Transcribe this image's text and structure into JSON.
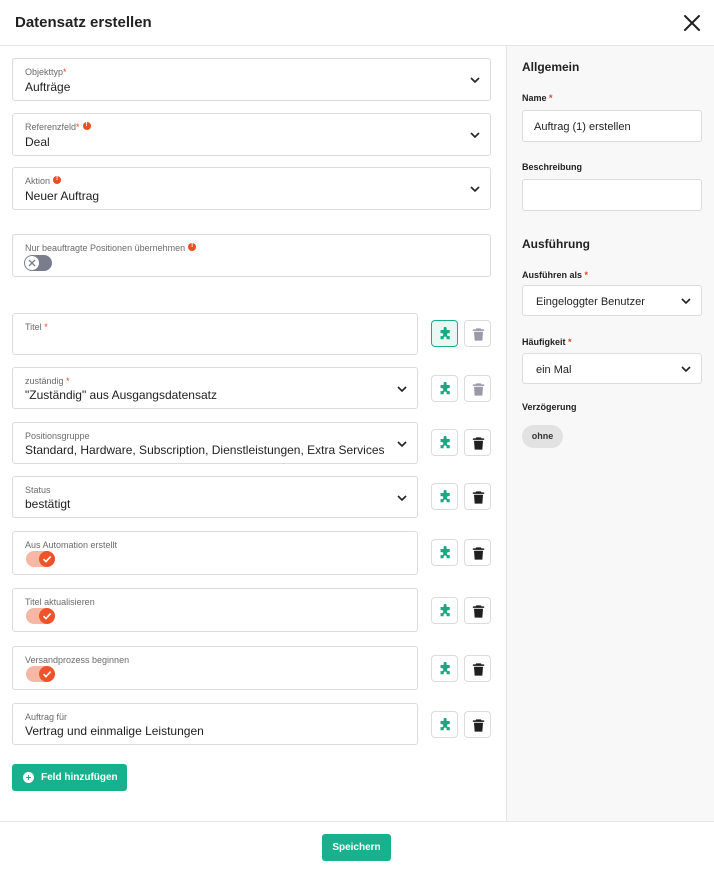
{
  "dialog": {
    "title": "Datensatz erstellen"
  },
  "form": {
    "objekttyp": {
      "label": "Objekttyp",
      "required_mark": "*",
      "value": "Aufträge"
    },
    "referenzfeld": {
      "label": "Referenzfeld",
      "required_mark": "*",
      "value": "Deal"
    },
    "aktion": {
      "label": "Aktion",
      "value": "Neuer Auftrag"
    },
    "nur_beauftragte": {
      "label": "Nur beauftragte Positionen übernehmen",
      "on": false
    },
    "fields": [
      {
        "label": "Titel",
        "required_mark": "*",
        "value": ""
      },
      {
        "label": "zuständig",
        "required_mark": "*",
        "value": "\"Zuständig\" aus Ausgangsdatensatz"
      },
      {
        "label": "Positionsgruppe",
        "value": "Standard, Hardware, Subscription, Dienstleistungen, Extra Services"
      },
      {
        "label": "Status",
        "value": "bestätigt"
      },
      {
        "label": "Aus Automation erstellt",
        "on": true
      },
      {
        "label": "Titel aktualisieren",
        "on": true
      },
      {
        "label": "Versandprozess beginnen",
        "on": true
      },
      {
        "label": "Auftrag für",
        "value": "Vertrag und einmalige Leistungen"
      }
    ],
    "add_field_label": "Feld hinzufügen"
  },
  "sidebar": {
    "allgemein_title": "Allgemein",
    "name_label": "Name",
    "name_required": "*",
    "name_value": "Auftrag (1) erstellen",
    "beschreibung_label": "Beschreibung",
    "beschreibung_value": "",
    "ausfuehrung_title": "Ausführung",
    "ausfuehren_als_label": "Ausführen als",
    "ausfuehren_als_required": "*",
    "ausfuehren_als_value": "Eingeloggter Benutzer",
    "haeufigkeit_label": "Häufigkeit",
    "haeufigkeit_required": "*",
    "haeufigkeit_value": "ein Mal",
    "verzoegerung_label": "Verzögerung",
    "verzoegerung_value": "ohne"
  },
  "footer": {
    "save_label": "Speichern"
  },
  "colors": {
    "accent": "#19b08d",
    "required": "#e0452b",
    "toggle_on": "#f0522a"
  }
}
